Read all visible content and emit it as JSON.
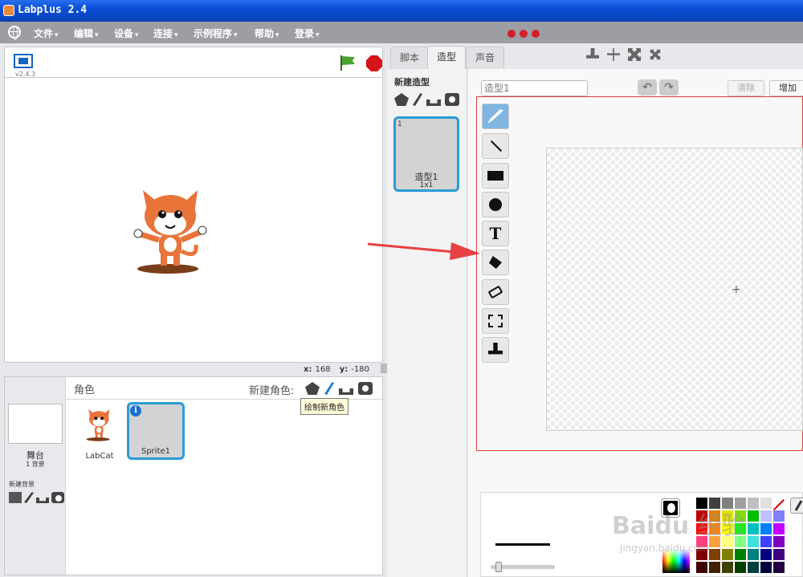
{
  "window": {
    "title": "Labplus 2.4"
  },
  "menubar": {
    "items": [
      {
        "label": "文件"
      },
      {
        "label": "编辑"
      },
      {
        "label": "设备"
      },
      {
        "label": "连接"
      },
      {
        "label": "示例程序"
      },
      {
        "label": "帮助"
      },
      {
        "label": "登录"
      }
    ],
    "caret": "▾"
  },
  "stage": {
    "version": "v2.4.3",
    "x_label": "x:",
    "x_value": "168",
    "y_label": "y:",
    "y_value": "-180"
  },
  "sprites_panel": {
    "title": "角色",
    "new_sprite_label": "新建角色:",
    "tooltip": "绘制新角色",
    "stage_label": "舞台",
    "backdrop_count": "1 背景",
    "new_backdrop_label": "新建背景",
    "sprites": [
      {
        "name": "LabCat",
        "selected": false
      },
      {
        "name": "Sprite1",
        "selected": true
      }
    ],
    "info_glyph": "i"
  },
  "tabs": [
    {
      "label": "脚本",
      "active": false
    },
    {
      "label": "造型",
      "active": true
    },
    {
      "label": "声音",
      "active": false
    }
  ],
  "costumes": {
    "new_costume_title": "新建造型",
    "items": [
      {
        "number": "1",
        "name": "造型1",
        "size": "1x1"
      }
    ]
  },
  "editor": {
    "costume_name_placeholder": "造型1",
    "undo_glyph": "↶",
    "redo_glyph": "↷",
    "clear_label": "清除",
    "add_label": "增加",
    "text_tool_glyph": "T",
    "center_glyph": "+"
  },
  "palette": {
    "colors": [
      "#000000",
      "#404040",
      "#808080",
      "#a0a0a0",
      "#c0c0c0",
      "#e0e0e0",
      "#ffffff",
      "#c00000",
      "#e08000",
      "#e0e000",
      "#80e000",
      "#00c000",
      "#c0c0ff",
      "#8080ff",
      "#ff0000",
      "#ff8000",
      "#ffff00",
      "#00ff00",
      "#00c0c0",
      "#0080ff",
      "#c000ff",
      "#ff4080",
      "#ffa040",
      "#ffff80",
      "#80ff80",
      "#40e0e0",
      "#4040ff",
      "#8000c0",
      "#800000",
      "#804000",
      "#808000",
      "#008000",
      "#008080",
      "#000080",
      "#400080",
      "#400000",
      "#402000",
      "#404000",
      "#004000",
      "#004040",
      "#000040",
      "#200040"
    ],
    "foreground": "#000000"
  },
  "watermark": {
    "main": "Baidu 经验",
    "sub": "jingyan.baidu.com"
  },
  "colors": {
    "title_bar": "#0a4fd6",
    "menu_bar": "#9c9ea3",
    "accent": "#2a9bd6",
    "highlight": "#e04040"
  }
}
